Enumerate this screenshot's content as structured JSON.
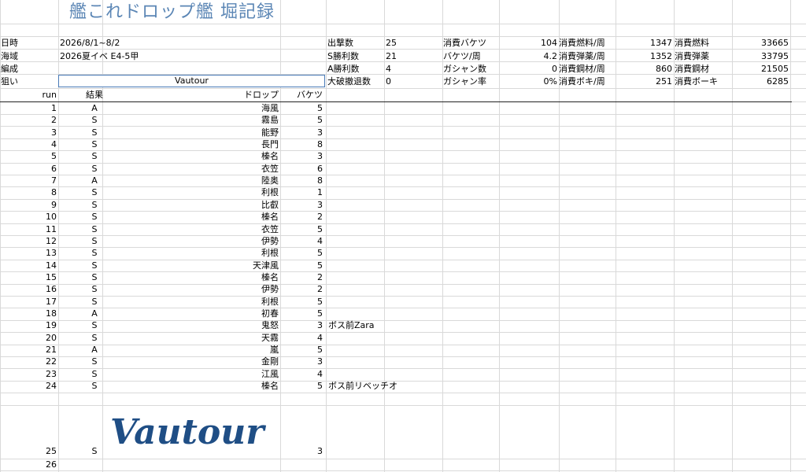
{
  "title": "艦これドロップ艦 堀記録",
  "info": {
    "date_label": "日時",
    "date_value": "2026/8/1~8/2",
    "area_label": "海域",
    "area_value": "2026夏イベ E4-5甲",
    "fleet_label": "編成",
    "fleet_value": "",
    "target_label": "狙い",
    "target_value": "Vautour"
  },
  "stats": {
    "sorties_label": "出撃数",
    "sorties_value": "25",
    "s_wins_label": "S勝利数",
    "s_wins_value": "21",
    "a_wins_label": "A勝利数",
    "a_wins_value": "4",
    "retreat_label": "大破撤退数",
    "retreat_value": "0",
    "bucket_used_label": "消費バケツ",
    "bucket_used_value": "104",
    "bucket_per_label": "バケツ/周",
    "bucket_per_value": "4.2",
    "gacha_count_label": "ガシャン数",
    "gacha_count_value": "0",
    "gacha_rate_label": "ガシャン率",
    "gacha_rate_value": "0%",
    "fuel_per_label": "消費燃料/周",
    "fuel_per_value": "1347",
    "ammo_per_label": "消費弾薬/周",
    "ammo_per_value": "1352",
    "steel_per_label": "消費鋼材/周",
    "steel_per_value": "860",
    "baux_per_label": "消費ボキ/周",
    "baux_per_value": "251",
    "fuel_total_label": "消費燃料",
    "fuel_total_value": "33665",
    "ammo_total_label": "消費弾薬",
    "ammo_total_value": "33795",
    "steel_total_label": "消費鋼材",
    "steel_total_value": "21505",
    "baux_total_label": "消費ボーキ",
    "baux_total_value": "6285"
  },
  "table": {
    "headers": {
      "run": "run",
      "result": "結果",
      "drop": "ドロップ",
      "bucket": "バケツ"
    },
    "rows": [
      {
        "run": "1",
        "result": "A",
        "drop": "海風",
        "bucket": "5",
        "note": ""
      },
      {
        "run": "2",
        "result": "S",
        "drop": "霧島",
        "bucket": "5",
        "note": ""
      },
      {
        "run": "3",
        "result": "S",
        "drop": "能野",
        "bucket": "3",
        "note": ""
      },
      {
        "run": "4",
        "result": "S",
        "drop": "長門",
        "bucket": "8",
        "note": ""
      },
      {
        "run": "5",
        "result": "S",
        "drop": "榛名",
        "bucket": "3",
        "note": ""
      },
      {
        "run": "6",
        "result": "S",
        "drop": "衣笠",
        "bucket": "6",
        "note": ""
      },
      {
        "run": "7",
        "result": "A",
        "drop": "陸奥",
        "bucket": "8",
        "note": ""
      },
      {
        "run": "8",
        "result": "S",
        "drop": "利根",
        "bucket": "1",
        "note": ""
      },
      {
        "run": "9",
        "result": "S",
        "drop": "比叡",
        "bucket": "3",
        "note": ""
      },
      {
        "run": "10",
        "result": "S",
        "drop": "榛名",
        "bucket": "2",
        "note": ""
      },
      {
        "run": "11",
        "result": "S",
        "drop": "衣笠",
        "bucket": "5",
        "note": ""
      },
      {
        "run": "12",
        "result": "S",
        "drop": "伊勢",
        "bucket": "4",
        "note": ""
      },
      {
        "run": "13",
        "result": "S",
        "drop": "利根",
        "bucket": "5",
        "note": ""
      },
      {
        "run": "14",
        "result": "S",
        "drop": "天津風",
        "bucket": "5",
        "note": ""
      },
      {
        "run": "15",
        "result": "S",
        "drop": "榛名",
        "bucket": "2",
        "note": ""
      },
      {
        "run": "16",
        "result": "S",
        "drop": "伊勢",
        "bucket": "2",
        "note": ""
      },
      {
        "run": "17",
        "result": "S",
        "drop": "利根",
        "bucket": "5",
        "note": ""
      },
      {
        "run": "18",
        "result": "A",
        "drop": "初春",
        "bucket": "5",
        "note": ""
      },
      {
        "run": "19",
        "result": "S",
        "drop": "鬼怒",
        "bucket": "3",
        "note": "ボス前Zara"
      },
      {
        "run": "20",
        "result": "S",
        "drop": "天霧",
        "bucket": "4",
        "note": ""
      },
      {
        "run": "21",
        "result": "A",
        "drop": "嵐",
        "bucket": "5",
        "note": ""
      },
      {
        "run": "22",
        "result": "S",
        "drop": "金剛",
        "bucket": "3",
        "note": ""
      },
      {
        "run": "23",
        "result": "S",
        "drop": "江風",
        "bucket": "4",
        "note": ""
      },
      {
        "run": "24",
        "result": "S",
        "drop": "榛名",
        "bucket": "5",
        "note": "ボス前リベッチオ"
      },
      {
        "run": "25",
        "result": "S",
        "drop": "Vautour",
        "bucket": "3",
        "note": ""
      },
      {
        "run": "26",
        "result": "",
        "drop": "",
        "bucket": "",
        "note": ""
      }
    ]
  }
}
